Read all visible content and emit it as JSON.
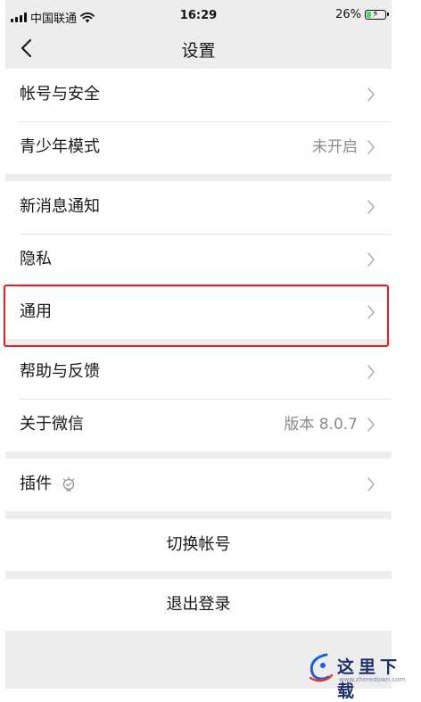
{
  "status_bar": {
    "carrier": "中国联通",
    "time": "16:29",
    "battery_percent": "26%",
    "battery_level": 0.26,
    "signal_icon": "signal-bars-icon",
    "wifi_icon": "wifi-icon",
    "battery_icon": "battery-charging-icon"
  },
  "nav": {
    "title": "设置",
    "back_icon": "chevron-left-icon"
  },
  "groups": [
    {
      "items": [
        {
          "label": "帐号与安全",
          "value": ""
        },
        {
          "label": "青少年模式",
          "value": "未开启"
        }
      ]
    },
    {
      "items": [
        {
          "label": "新消息通知",
          "value": ""
        },
        {
          "label": "隐私",
          "value": ""
        },
        {
          "label": "通用",
          "value": "",
          "highlighted": true
        }
      ]
    },
    {
      "items": [
        {
          "label": "帮助与反馈",
          "value": ""
        },
        {
          "label": "关于微信",
          "value": "版本 8.0.7"
        }
      ]
    },
    {
      "items": [
        {
          "label": "插件",
          "value": "",
          "icon": "plugin-bulb-icon"
        }
      ]
    }
  ],
  "actions": {
    "switch_account": "切换帐号",
    "logout": "退出登录"
  },
  "watermark": {
    "text": "这里下载",
    "url": "www.zheredown.com"
  },
  "colors": {
    "page_bg": "#ededed",
    "cell_bg": "#ffffff",
    "secondary_text": "#8a8a8a",
    "highlight_border": "#e02020",
    "battery_fill": "#4cd964"
  }
}
